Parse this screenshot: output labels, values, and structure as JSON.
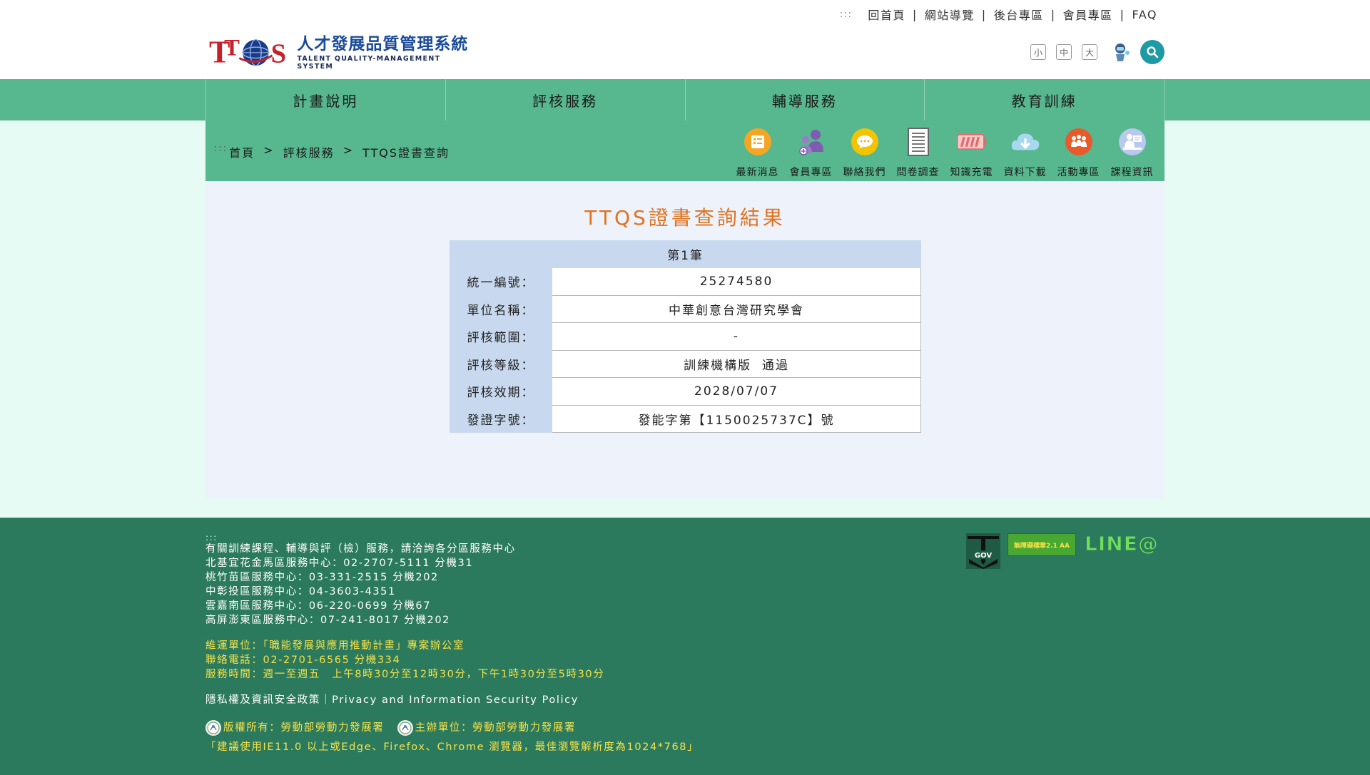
{
  "header": {
    "accesskey": ":::",
    "toplinks": [
      "回首頁",
      "網站導覽",
      "後台專區",
      "會員專區",
      "FAQ"
    ],
    "logo_cn": "人才發展品質管理系統",
    "logo_en": "TALENT QUALITY-MANAGEMENT SYSTEM",
    "font_sizes": [
      "小",
      "中",
      "大"
    ]
  },
  "mainnav": [
    "計畫說明",
    "評核服務",
    "輔導服務",
    "教育訓練"
  ],
  "breadcrumb": {
    "accesskey": ":::",
    "items": [
      "首頁",
      "評核服務",
      "TTQS證書查詢"
    ]
  },
  "quicklinks": [
    {
      "label": "最新消息",
      "icon": "news-icon"
    },
    {
      "label": "會員專區",
      "icon": "members-icon"
    },
    {
      "label": "聯絡我們",
      "icon": "chat-icon"
    },
    {
      "label": "問卷調查",
      "icon": "survey-icon"
    },
    {
      "label": "知識充電",
      "icon": "battery-icon"
    },
    {
      "label": "資料下載",
      "icon": "cloud-download-icon"
    },
    {
      "label": "活動專區",
      "icon": "activity-icon"
    },
    {
      "label": "課程資訊",
      "icon": "course-icon"
    }
  ],
  "result": {
    "title": "TTQS證書查詢結果",
    "record_label": "第1筆",
    "rows": [
      {
        "key": "統一編號：",
        "value": "25274580"
      },
      {
        "key": "單位名稱：",
        "value": "中華創意台灣研究學會"
      },
      {
        "key": "評核範圍：",
        "value": "-"
      },
      {
        "key": "評核等級：",
        "value": "訓練機構版  通過"
      },
      {
        "key": "評核效期：",
        "value": "2028/07/07"
      },
      {
        "key": "發證字號：",
        "value": "發能字第【1150025737C】號"
      }
    ]
  },
  "footer": {
    "accesskey": ":::",
    "intro": "有關訓練課程、輔導與評（檢）服務，請洽詢各分區服務中心",
    "centers": [
      "北基宜花金馬區服務中心：02-2707-5111 分機31",
      "桃竹苗區服務中心：03-331-2515 分機202",
      "中彰投區服務中心：04-3603-4351",
      "雲嘉南區服務中心：06-220-0699 分機67",
      "高屏澎東區服務中心：07-241-8017 分機202"
    ],
    "operator": "維運單位：「職能發展與應用推動計畫」專案辦公室",
    "phone": "聯絡電話：02-2701-6565 分機334",
    "hours": "服務時間：週一至週五　上午8時30分至12時30分，下午1時30分至5時30分",
    "privacy": "隱私權及資訊安全政策｜Privacy and Information Security Policy",
    "copyright": "版權所有：勞動部勞動力發展署",
    "organizer": "主辦單位：勞動部勞動力發展署",
    "browser_note": "「建議使用IE11.0 以上或Edge、Firefox、Chrome 瀏覽器，最佳瀏覽解析度為1024*768」",
    "badges": {
      "gov": "GOV",
      "accessibility": "無障礙標章2.1 AA",
      "line": "LINE@"
    }
  }
}
